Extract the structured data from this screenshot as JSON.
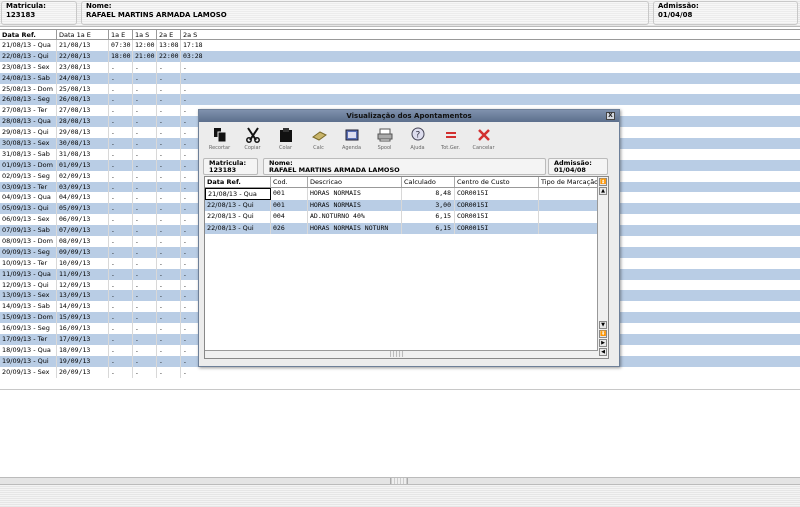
{
  "header": {
    "matricula_label": "Matricula:",
    "matricula_value": "123183",
    "nome_label": "Nome:",
    "nome_value": "RAFAEL MARTINS ARMADA LAMOSO",
    "admissao_label": "Admissão:",
    "admissao_value": "01/04/08"
  },
  "grid": {
    "columns": [
      "Data Ref.",
      "Data 1a E",
      "1a E",
      "1a S",
      "2a E",
      "2a S"
    ],
    "rows": [
      [
        "21/08/13 - Qua",
        "21/08/13",
        "07:30",
        "12:00",
        "13:08",
        "17:18"
      ],
      [
        "22/08/13 - Qui",
        "22/08/13",
        "18:00",
        "21:00",
        "22:00",
        "03:28"
      ],
      [
        "23/08/13 - Sex",
        "23/08/13",
        ".",
        ".",
        ".",
        "."
      ],
      [
        "24/08/13 - Sab",
        "24/08/13",
        ".",
        ".",
        ".",
        "."
      ],
      [
        "25/08/13 - Dom",
        "25/08/13",
        ".",
        ".",
        ".",
        "."
      ],
      [
        "26/08/13 - Seg",
        "26/08/13",
        ".",
        ".",
        ".",
        "."
      ],
      [
        "27/08/13 - Ter",
        "27/08/13",
        ".",
        ".",
        ".",
        "."
      ],
      [
        "28/08/13 - Qua",
        "28/08/13",
        ".",
        ".",
        ".",
        "."
      ],
      [
        "29/08/13 - Qui",
        "29/08/13",
        ".",
        ".",
        ".",
        "."
      ],
      [
        "30/08/13 - Sex",
        "30/08/13",
        ".",
        ".",
        ".",
        "."
      ],
      [
        "31/08/13 - Sab",
        "31/08/13",
        ".",
        ".",
        ".",
        "."
      ],
      [
        "01/09/13 - Dom",
        "01/09/13",
        ".",
        ".",
        ".",
        "."
      ],
      [
        "02/09/13 - Seg",
        "02/09/13",
        ".",
        ".",
        ".",
        "."
      ],
      [
        "03/09/13 - Ter",
        "03/09/13",
        ".",
        ".",
        ".",
        "."
      ],
      [
        "04/09/13 - Qua",
        "04/09/13",
        ".",
        ".",
        ".",
        "."
      ],
      [
        "05/09/13 - Qui",
        "05/09/13",
        ".",
        ".",
        ".",
        "."
      ],
      [
        "06/09/13 - Sex",
        "06/09/13",
        ".",
        ".",
        ".",
        "."
      ],
      [
        "07/09/13 - Sab",
        "07/09/13",
        ".",
        ".",
        ".",
        "."
      ],
      [
        "08/09/13 - Dom",
        "08/09/13",
        ".",
        ".",
        ".",
        "."
      ],
      [
        "09/09/13 - Seg",
        "09/09/13",
        ".",
        ".",
        ".",
        "."
      ],
      [
        "10/09/13 - Ter",
        "10/09/13",
        ".",
        ".",
        ".",
        "."
      ],
      [
        "11/09/13 - Qua",
        "11/09/13",
        ".",
        ".",
        ".",
        "."
      ],
      [
        "12/09/13 - Qui",
        "12/09/13",
        ".",
        ".",
        ".",
        "."
      ],
      [
        "13/09/13 - Sex",
        "13/09/13",
        ".",
        ".",
        ".",
        "."
      ],
      [
        "14/09/13 - Sab",
        "14/09/13",
        ".",
        ".",
        ".",
        "."
      ],
      [
        "15/09/13 - Dom",
        "15/09/13",
        ".",
        ".",
        ".",
        "."
      ],
      [
        "16/09/13 - Seg",
        "16/09/13",
        ".",
        ".",
        ".",
        "."
      ],
      [
        "17/09/13 - Ter",
        "17/09/13",
        ".",
        ".",
        ".",
        "."
      ],
      [
        "18/09/13 - Qua",
        "18/09/13",
        ".",
        ".",
        ".",
        "."
      ],
      [
        "19/09/13 - Qui",
        "19/09/13",
        ".",
        ".",
        ".",
        "."
      ],
      [
        "20/09/13 - Sex",
        "20/09/13",
        ".",
        ".",
        ".",
        "."
      ]
    ]
  },
  "modal": {
    "title": "Visualização dos Apontamentos",
    "close_label": "X",
    "toolbar": [
      {
        "label": "Recortar",
        "icon": "cut-copy-icon"
      },
      {
        "label": "Copiar",
        "icon": "scissors-icon"
      },
      {
        "label": "Colar",
        "icon": "paste-icon"
      },
      {
        "label": "Calc",
        "icon": "calculator-icon"
      },
      {
        "label": "Agenda",
        "icon": "agenda-icon"
      },
      {
        "label": "Spool",
        "icon": "spool-icon"
      },
      {
        "label": "Ajuda",
        "icon": "help-icon"
      },
      {
        "label": "Tot.Ger.",
        "icon": "equals-icon"
      },
      {
        "label": "Cancelar",
        "icon": "cancel-icon"
      }
    ],
    "header": {
      "matricula_label": "Matricula:",
      "matricula_value": "123183",
      "nome_label": "Nome:",
      "nome_value": "RAFAEL MARTINS ARMADA LAMOSO",
      "admissao_label": "Admissão:",
      "admissao_value": "01/04/08"
    },
    "grid": {
      "columns": [
        "Data Ref.",
        "Cod.",
        "Descricao",
        "Calculado",
        "Centro de Custo",
        "Tipo de Marcação"
      ],
      "rows": [
        [
          "21/08/13 - Qua",
          "001",
          "HORAS NORMAIS",
          "8,48",
          "COR0015I",
          ""
        ],
        [
          "22/08/13 - Qui",
          "001",
          "HORAS NORMAIS",
          "3,00",
          "COR0015I",
          ""
        ],
        [
          "22/08/13 - Qui",
          "004",
          "AD.NOTURNO 40%",
          "6,15",
          "COR0015I",
          ""
        ],
        [
          "22/08/13 - Qui",
          "026",
          "HORAS NORMAIS NOTURN",
          "6,15",
          "COR0015I",
          ""
        ]
      ]
    }
  },
  "colors": {
    "row_alt": "#b9cde5",
    "title_bar": "#6b7e9b",
    "cancel_red": "#d23030"
  }
}
